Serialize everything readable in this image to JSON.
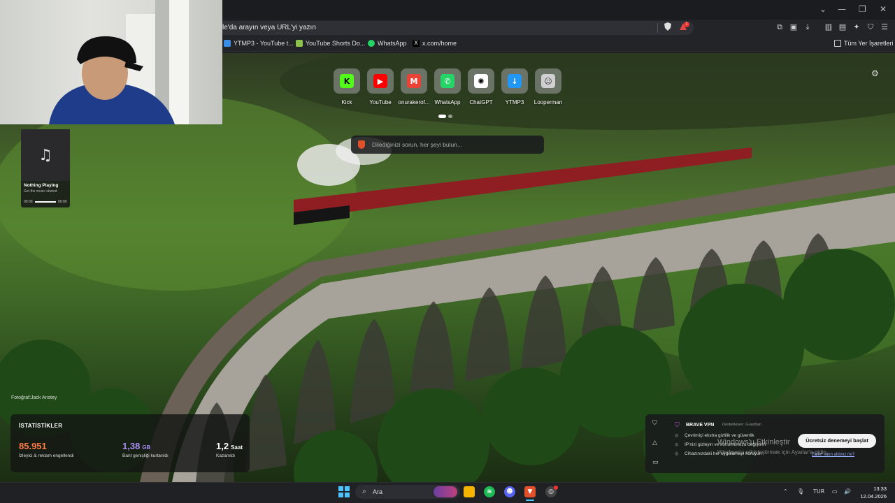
{
  "browser": {
    "url_placeholder": "le'da arayın veya URL'yi yazın",
    "vpn_badge_count": "1",
    "window_controls": {
      "collapse": "⌄",
      "minimize": "—",
      "maximize": "❐",
      "close": "✕"
    }
  },
  "bookmarks": {
    "items": [
      {
        "label": "YTMP3 - YouTube t...",
        "icon": "ytmp3-icon",
        "color": "#3a8ee6"
      },
      {
        "label": "YouTube Shorts Do...",
        "icon": "download-arrow-icon",
        "color": "#8bc34a"
      },
      {
        "label": "WhatsApp",
        "icon": "whatsapp-icon",
        "color": "#25d366"
      },
      {
        "label": "x.com/home",
        "icon": "x-icon",
        "color": "#000000"
      }
    ],
    "all_bookmarks": "Tüm Yer İşaretleri"
  },
  "music": {
    "title": "Nothing Playing",
    "subtitle": "Get the music started",
    "time_start": "00:00",
    "time_end": "00:00"
  },
  "top_sites": [
    {
      "label": "Kick",
      "glyph": "K",
      "color": "#53fc18",
      "fg": "#000000"
    },
    {
      "label": "YouTube",
      "glyph": "▶",
      "color": "#ff0000",
      "fg": "#ffffff"
    },
    {
      "label": "onurakerof...",
      "glyph": "M",
      "color": "#ea4335",
      "fg": "#ffffff"
    },
    {
      "label": "WhatsApp",
      "glyph": "✆",
      "color": "#25d366",
      "fg": "#ffffff"
    },
    {
      "label": "ChatGPT",
      "glyph": "✺",
      "color": "#ffffff",
      "fg": "#000000"
    },
    {
      "label": "YTMP3",
      "glyph": "↓",
      "color": "#2196f3",
      "fg": "#ffffff"
    },
    {
      "label": "Looperman",
      "glyph": "☺",
      "color": "#d0d0d0",
      "fg": "#333333"
    }
  ],
  "search": {
    "placeholder": "Dilediğinizi sorun, her şeyi bulun..."
  },
  "photo_credit": "Fotoğraf:Jack Anstey",
  "stats": {
    "title": "İSTATİSTİKLER",
    "trackers_value": "85.951",
    "trackers_label": "İzleyici & reklam engellendi",
    "bandwidth_value": "1,38",
    "bandwidth_unit": "GB",
    "bandwidth_label": "Bant genişliği kurtarıldı",
    "time_value": "1,2",
    "time_unit": "Saat",
    "time_label": "Kazanıldı"
  },
  "vpn": {
    "title": "BRAVE VPN",
    "sub": "Destekleyen:  Guardian",
    "features": [
      "Çevrimiçi ekstra gizlilik ve güvenlik",
      "IP'nizi gizleyin ve konumunuzu değiştirin",
      "Cihazınızdaki her uygulamayı koruyun"
    ],
    "cta": "Ücretsiz denemeyi başlat",
    "link": "Zaten satın aldınız mı?"
  },
  "activation_watermark": {
    "line1": "Windows'u Etkinleştir",
    "line2": "Windows'u etkinleştirmek için Ayarlar'a gidin."
  },
  "taskbar": {
    "search_label": "Ara",
    "language": "TUR",
    "time": "13:33",
    "date": "12.04.2026"
  }
}
